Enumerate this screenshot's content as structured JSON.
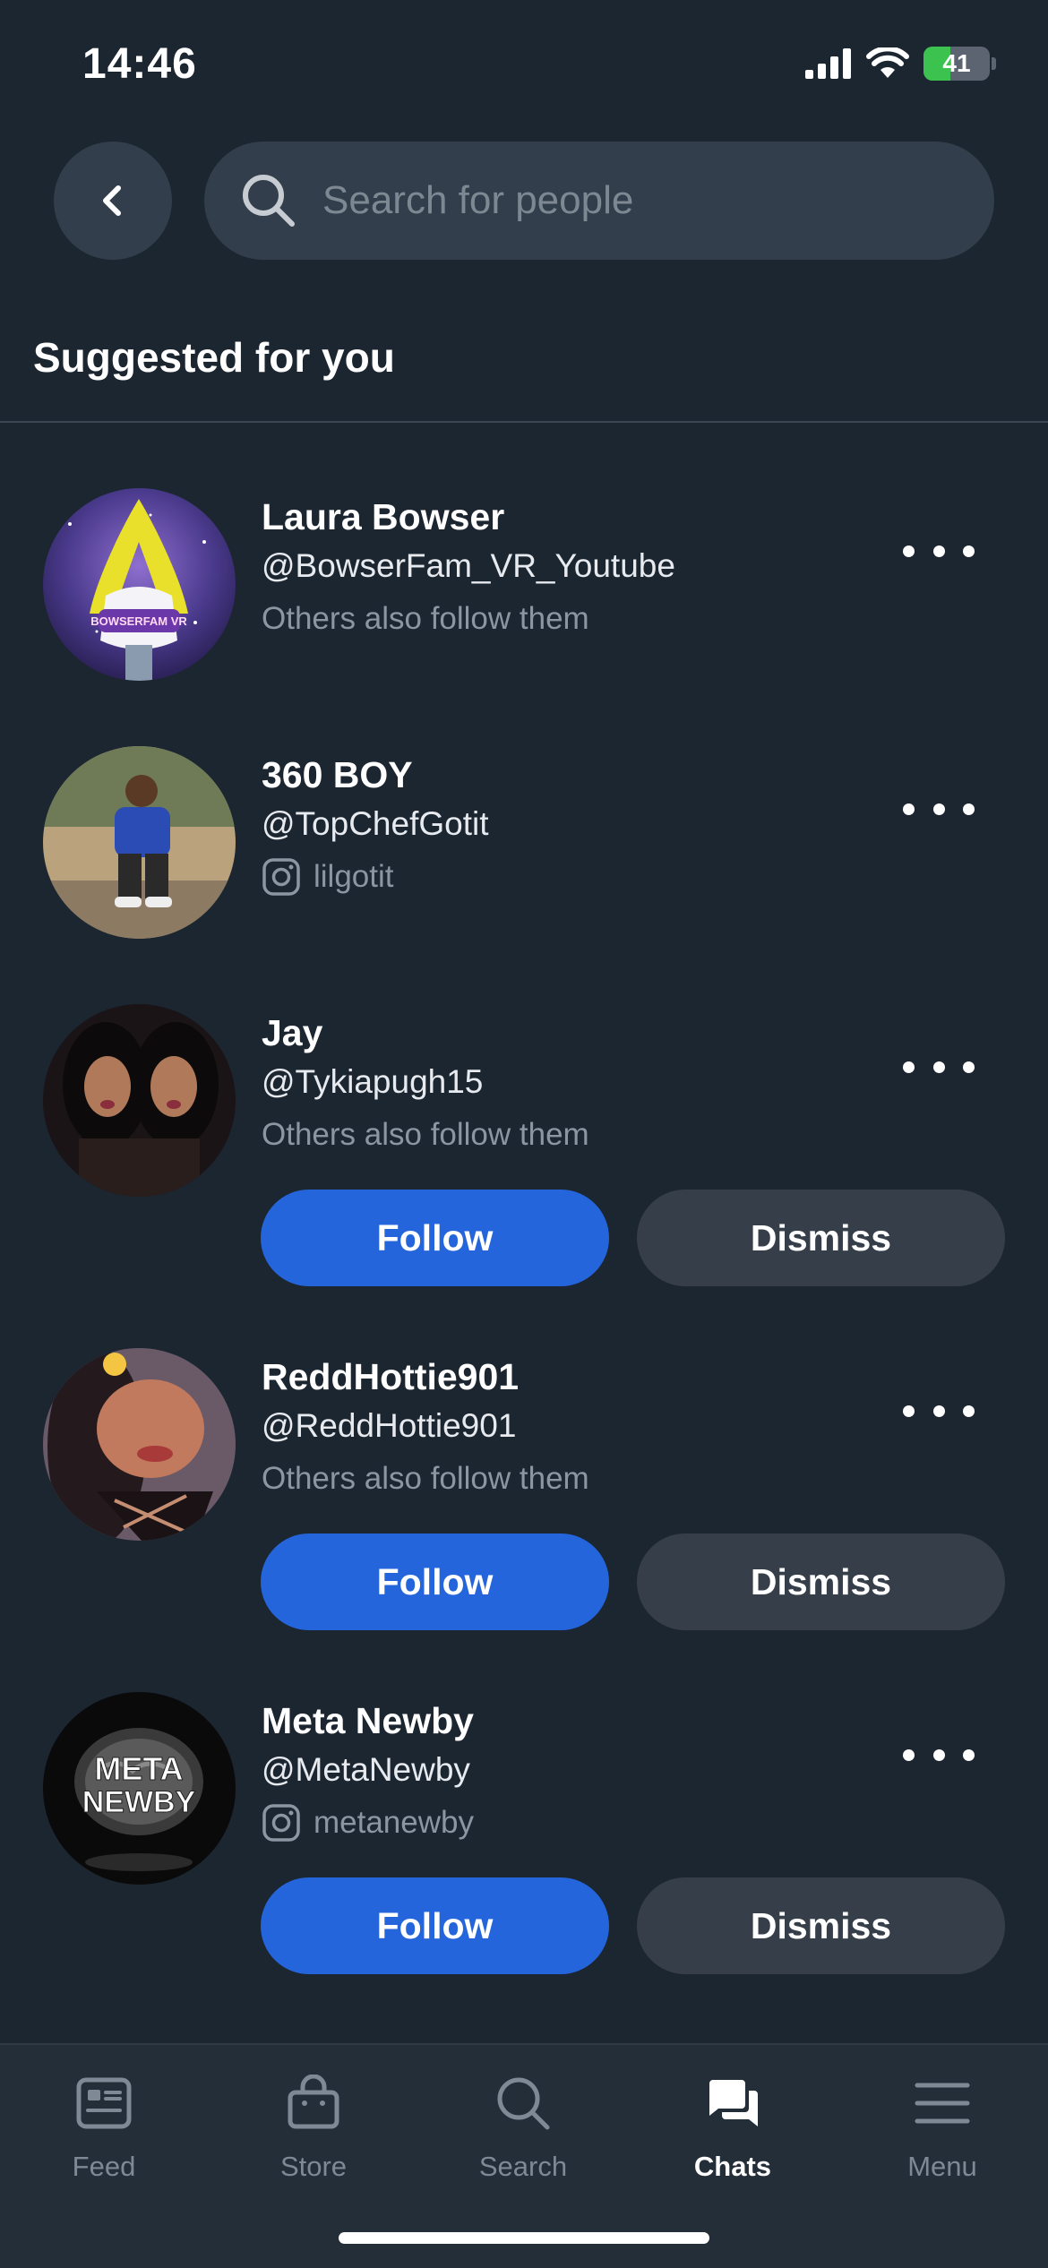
{
  "status": {
    "time": "14:46",
    "battery": "41",
    "battery_level": 0.41
  },
  "search": {
    "placeholder": "Search for people"
  },
  "section_title": "Suggested for you",
  "people": [
    {
      "name": "Laura Bowser",
      "handle": "@BowserFam_VR_Youtube",
      "sub": "Others also follow them"
    },
    {
      "name": "360 BOY",
      "handle": "@TopChefGotit",
      "sub": "lilgotit"
    },
    {
      "name": "Jay",
      "handle": "@Tykiapugh15",
      "sub": "Others also follow them",
      "follow": "Follow",
      "dismiss": "Dismiss"
    },
    {
      "name": "ReddHottie901",
      "handle": "@ReddHottie901",
      "sub": "Others also follow them",
      "follow": "Follow",
      "dismiss": "Dismiss"
    },
    {
      "name": "Meta Newby",
      "handle": "@MetaNewby",
      "sub": "metanewby",
      "follow": "Follow",
      "dismiss": "Dismiss"
    }
  ],
  "avatar_texts": {
    "laura": "BOWSERFAM VR",
    "meta_line1": "META",
    "meta_line2": "NEWBY"
  },
  "tabs": [
    {
      "label": "Feed",
      "icon": "feed-icon"
    },
    {
      "label": "Store",
      "icon": "store-bag-icon"
    },
    {
      "label": "Search",
      "icon": "search-icon"
    },
    {
      "label": "Chats",
      "icon": "chats-icon",
      "active": true
    },
    {
      "label": "Menu",
      "icon": "menu-icon"
    }
  ],
  "colors": {
    "background": "#1c2631",
    "follow_button": "#2565dc",
    "dismiss_button": "#363f49",
    "battery_green": "#3bc24f"
  }
}
